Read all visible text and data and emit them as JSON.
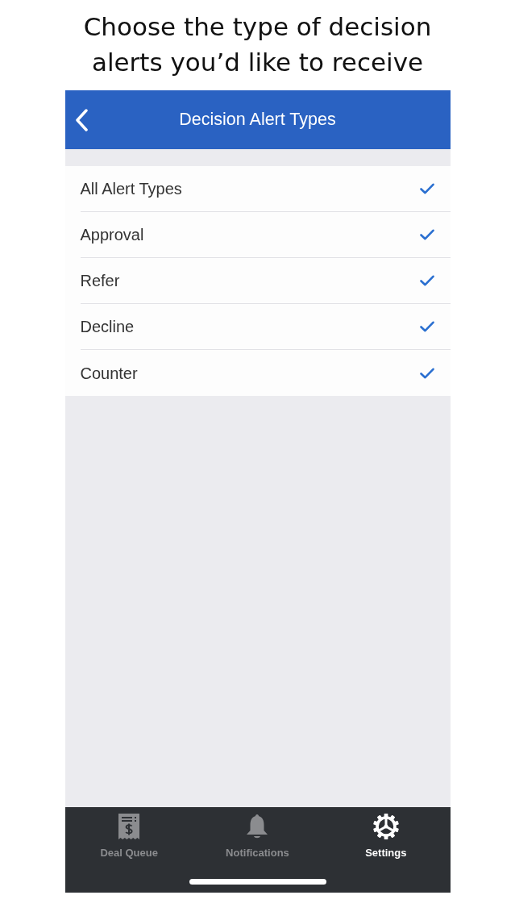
{
  "caption": "Choose the type of decision alerts you’d like to receive",
  "nav_bar": {
    "title": "Decision Alert Types",
    "back": true
  },
  "alert_types": [
    {
      "label": "All Alert Types",
      "checked": true
    },
    {
      "label": "Approval",
      "checked": true
    },
    {
      "label": "Refer",
      "checked": true
    },
    {
      "label": "Decline",
      "checked": true
    },
    {
      "label": "Counter",
      "checked": true
    }
  ],
  "tab_bar": [
    {
      "label": "Deal Queue",
      "kind": "receipt",
      "selected": false
    },
    {
      "label": "Notifications",
      "kind": "bell",
      "selected": false
    },
    {
      "label": "Settings",
      "kind": "gear",
      "selected": true
    }
  ]
}
